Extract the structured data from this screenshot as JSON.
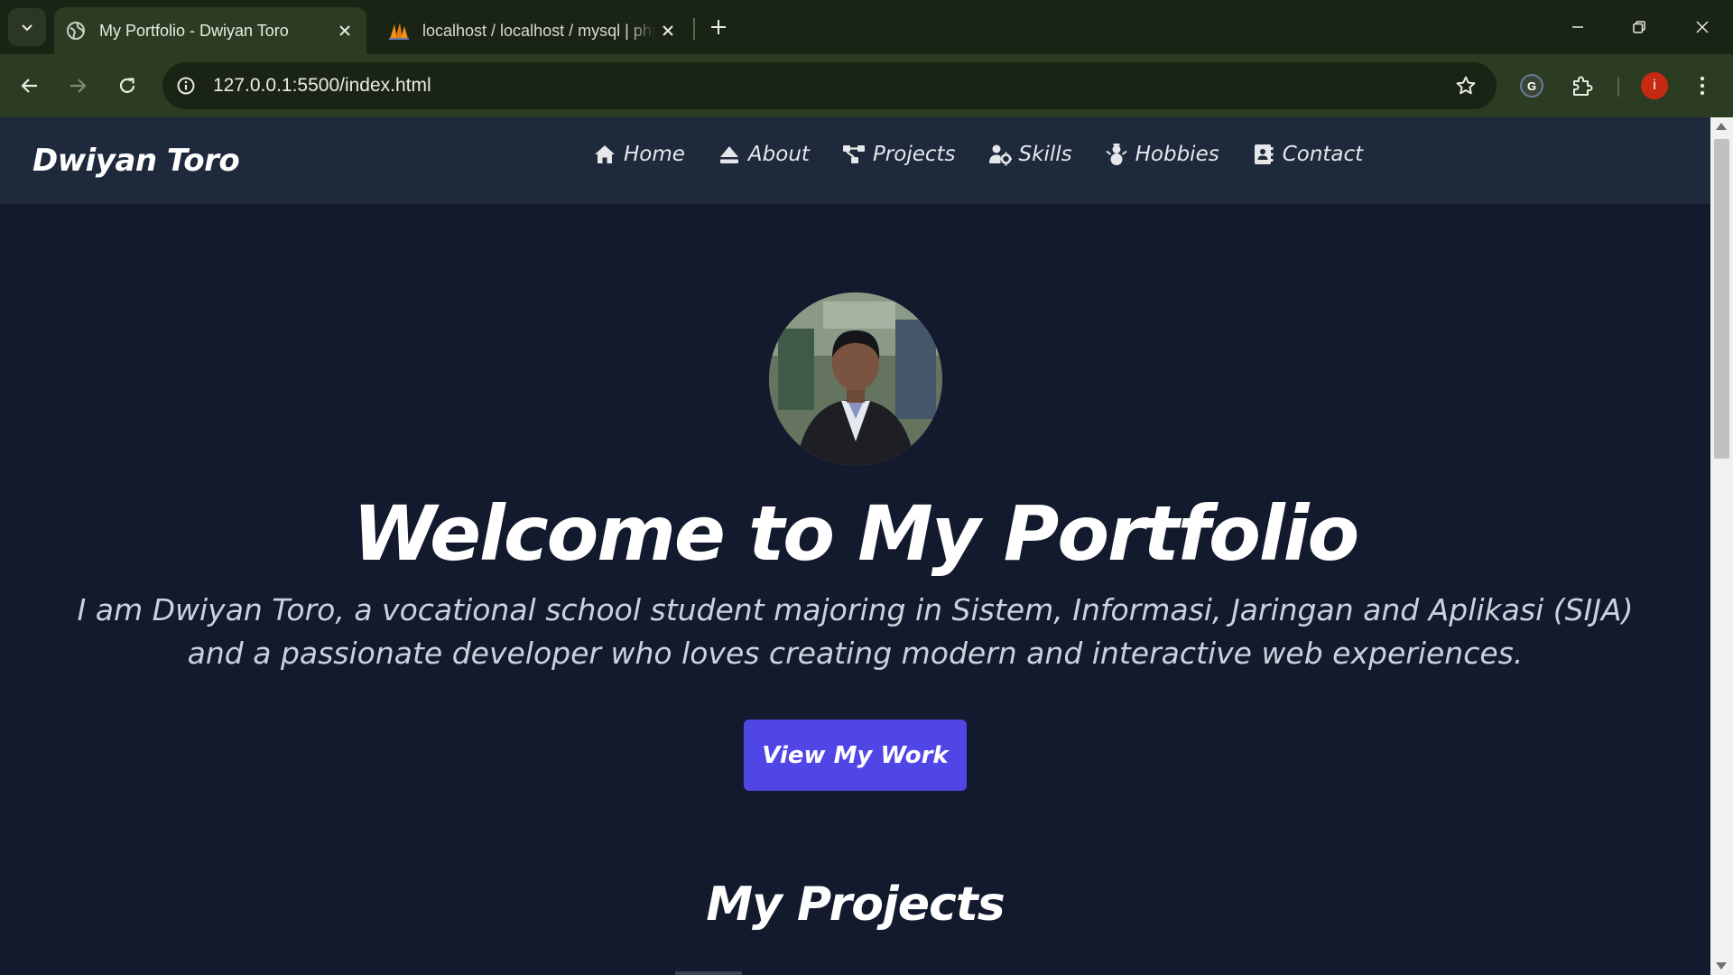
{
  "browser": {
    "tabs": [
      {
        "title": "My Portfolio - Dwiyan Toro",
        "favicon": "globe-icon",
        "active": true
      },
      {
        "title": "localhost / localhost / mysql | phpMyAdmin",
        "favicon": "phpmyadmin-icon",
        "active": false
      }
    ],
    "url": "127.0.0.1:5500/index.html",
    "profile_initial": "i",
    "extension_label": "G",
    "colors": {
      "tabbar": "#1a2414",
      "toolbar": "#2b3c22",
      "omnibox": "#1a2414",
      "profile": "#c62a12"
    }
  },
  "site": {
    "brand": "Dwiyan Toro",
    "nav": [
      {
        "label": "Home",
        "icon": "home-icon"
      },
      {
        "label": "About",
        "icon": "eject-icon"
      },
      {
        "label": "Projects",
        "icon": "project-diagram-icon"
      },
      {
        "label": "Skills",
        "icon": "user-gear-icon"
      },
      {
        "label": "Hobbies",
        "icon": "snowman-icon"
      },
      {
        "label": "Contact",
        "icon": "address-book-icon"
      }
    ],
    "hero": {
      "title": "Welcome to My Portfolio",
      "subtitle": "I am Dwiyan Toro, a vocational school student majoring in Sistem, Informasi, Jaringan and Aplikasi (SIJA) and a passionate developer who loves creating modern and interactive web experiences.",
      "cta": "View My Work"
    },
    "projects_heading": "My Projects",
    "colors": {
      "background": "#131a2e",
      "nav": "#1e293b",
      "accent": "#4f46e5",
      "text": "#ffffff"
    }
  }
}
